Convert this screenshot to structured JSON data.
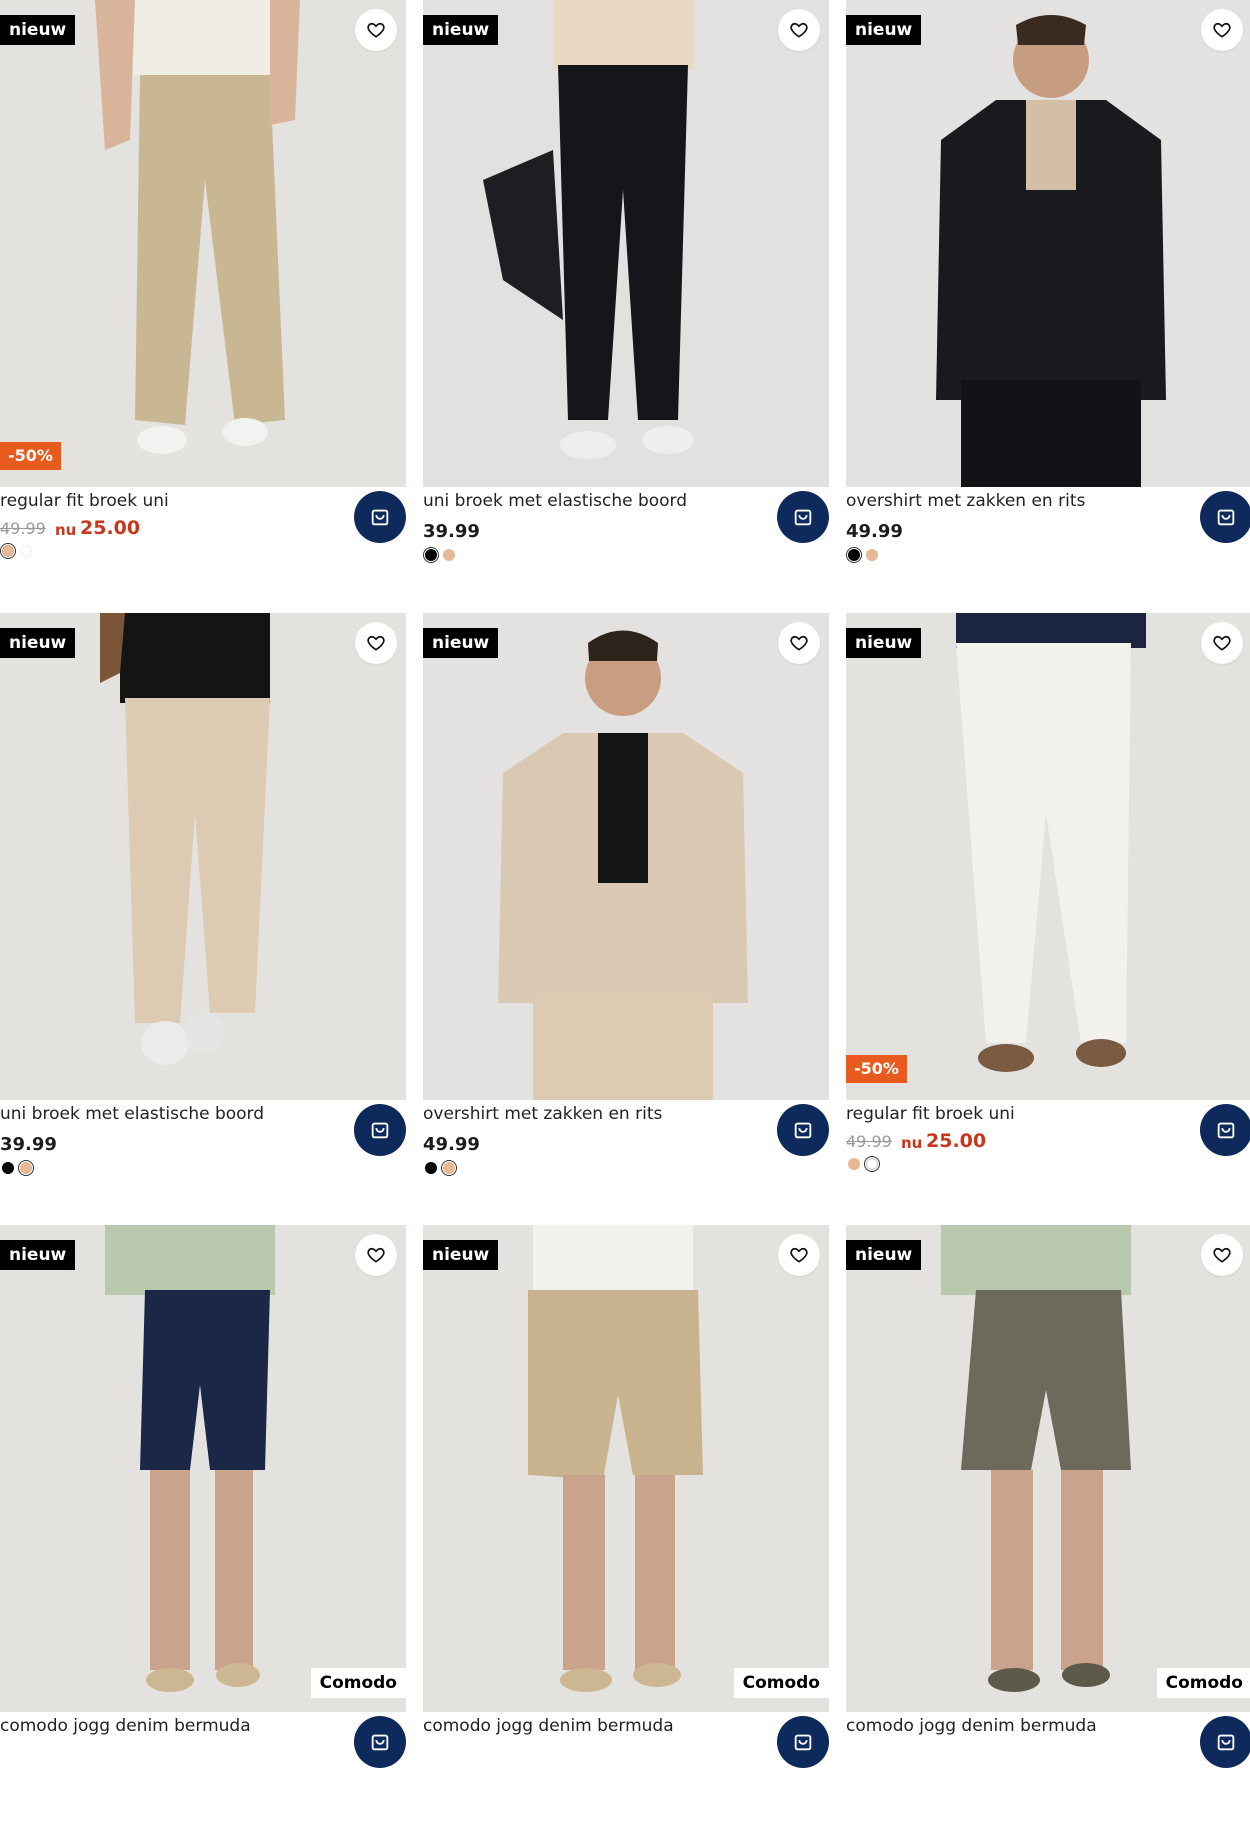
{
  "labels": {
    "new_badge": "nieuw",
    "now_label": "nu",
    "sale_badge": "-50%",
    "brand_badge": "Comodo"
  },
  "colors": {
    "navy_cart": "#0e2a5c",
    "sale_red": "#c8361b",
    "sale_badge_bg": "#e85a1e",
    "badge_black": "#000000"
  },
  "products": [
    {
      "name": "regular fit broek uni",
      "price_old": "49.99",
      "price_now": "25.00",
      "sale": true,
      "brand": "",
      "garment": "khaki-pants",
      "swatches": [
        "#e8b894",
        "#ffffff"
      ],
      "selected_swatch": 0
    },
    {
      "name": "uni broek met elastische boord",
      "price": "39.99",
      "sale": false,
      "brand": "",
      "garment": "black-pants",
      "swatches": [
        "#000000",
        "#e8b894"
      ],
      "selected_swatch": 0
    },
    {
      "name": "overshirt met zakken en rits",
      "price": "49.99",
      "sale": false,
      "brand": "",
      "garment": "black-jacket",
      "swatches": [
        "#000000",
        "#e8b894"
      ],
      "selected_swatch": 0
    },
    {
      "name": "uni broek met elastische boord",
      "price": "39.99",
      "sale": false,
      "brand": "",
      "garment": "beige-pants",
      "swatches": [
        "#000000",
        "#e8b894"
      ],
      "selected_swatch": 1
    },
    {
      "name": "overshirt met zakken en rits",
      "price": "49.99",
      "sale": false,
      "brand": "",
      "garment": "beige-jacket",
      "swatches": [
        "#000000",
        "#e8b894"
      ],
      "selected_swatch": 1
    },
    {
      "name": "regular fit broek uni",
      "price_old": "49.99",
      "price_now": "25.00",
      "sale": true,
      "brand": "",
      "garment": "white-pants",
      "swatches": [
        "#e8b894",
        "#ffffff"
      ],
      "selected_swatch": 1
    },
    {
      "name": "comodo jogg denim bermuda",
      "price": "",
      "sale": false,
      "brand": "Comodo",
      "garment": "navy-shorts",
      "swatches": [],
      "selected_swatch": -1
    },
    {
      "name": "comodo jogg denim bermuda",
      "price": "",
      "sale": false,
      "brand": "Comodo",
      "garment": "tan-shorts",
      "swatches": [],
      "selected_swatch": -1
    },
    {
      "name": "comodo jogg denim bermuda",
      "price": "",
      "sale": false,
      "brand": "Comodo",
      "garment": "olive-shorts",
      "swatches": [],
      "selected_swatch": -1
    }
  ]
}
